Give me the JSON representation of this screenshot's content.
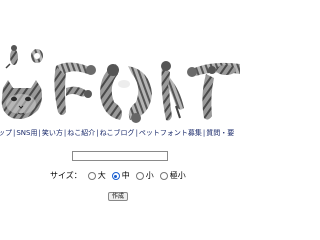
{
  "logo": {
    "alt_text": "ねこFONT"
  },
  "nav": {
    "items": [
      {
        "label": "ップ"
      },
      {
        "label": "SNS用"
      },
      {
        "label": "笑い方"
      },
      {
        "label": "ねこ紹介"
      },
      {
        "label": "ねこブログ"
      },
      {
        "label": "ペットフォント募集"
      },
      {
        "label": "質問・要"
      }
    ]
  },
  "form": {
    "text_value": "",
    "size_label": "サイズ：",
    "size_options": [
      {
        "label": "大",
        "checked": false
      },
      {
        "label": "中",
        "checked": true
      },
      {
        "label": "小",
        "checked": false
      },
      {
        "label": "極小",
        "checked": false
      }
    ],
    "submit_label": "作成"
  },
  "colors": {
    "nav_link": "#1a2a6b",
    "cat_gray": "#8f8f8f",
    "cat_dark": "#3b3b3b",
    "cat_light": "#d8d8d8"
  }
}
